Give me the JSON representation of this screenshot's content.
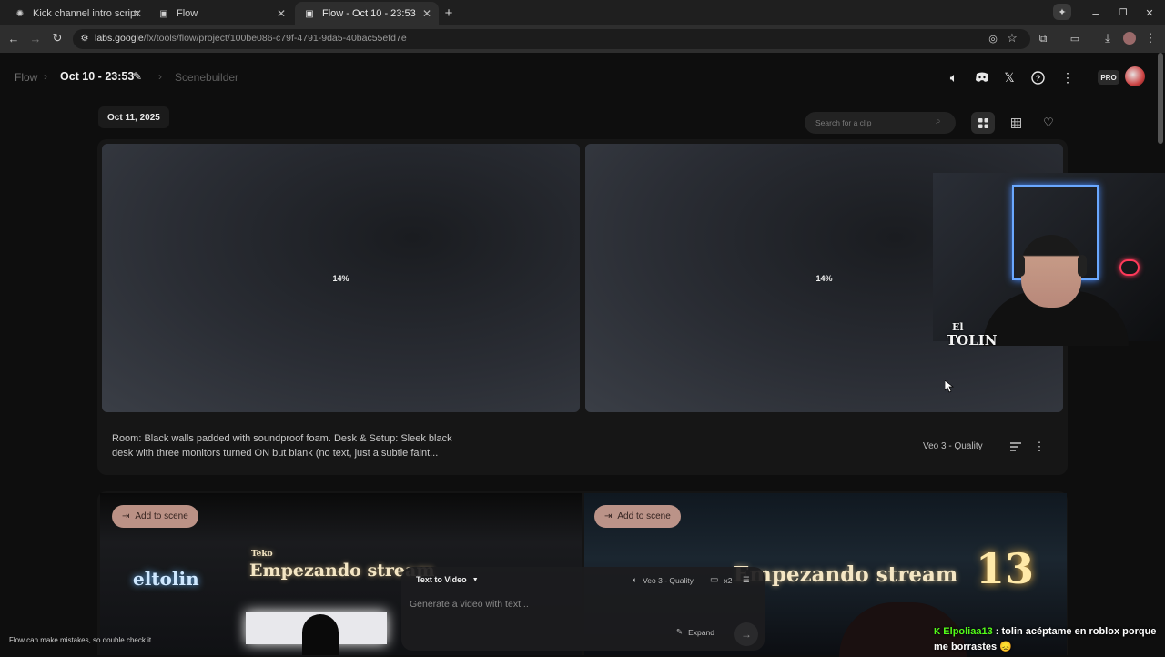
{
  "browser": {
    "tabs": [
      {
        "label": "Kick channel intro script",
        "icon": "gpt-icon"
      },
      {
        "label": "Flow",
        "icon": "flow-icon"
      },
      {
        "label": "Flow - Oct 10 - 23:53",
        "icon": "flow-icon",
        "active": true
      }
    ],
    "url_host": "labs.google",
    "url_path": "/fx/tools/flow/project/100be086-c79f-4791-9da5-40bac55efd7e"
  },
  "header": {
    "crumb_root": "Flow",
    "project_title": "Oct 10 - 23:53",
    "crumb_section": "Scenebuilder",
    "pro_badge": "PRO"
  },
  "toolbar": {
    "date_chip": "Oct 11, 2025",
    "search_placeholder": "Search for a clip"
  },
  "clip": {
    "progress_left": "14%",
    "progress_right": "14%",
    "prompt": "Room: Black walls padded with soundproof foam. Desk & Setup: Sleek black desk with three monitors turned ON but blank (no text, just a subtle faint...",
    "model": "Veo 3 - Quality"
  },
  "scenes": {
    "add_label": "Add to scene",
    "left_small_title": "Teko",
    "left_title": "Empezando stream",
    "left_logo": "eltolin",
    "right_title": "Empezando stream",
    "right_number": "13"
  },
  "composer": {
    "mode": "Text to Video",
    "model": "Veo 3 - Quality",
    "count": "x2",
    "placeholder": "Generate a video with text...",
    "expand": "Expand"
  },
  "footer": {
    "disclaimer": "Flow can make mistakes, so double check it"
  },
  "stream_overlay": {
    "cam_logo_line1": "El",
    "cam_logo_line2": "TOLIN",
    "chat_user": "Elpoliaa13",
    "chat_message": " : tolin acéptame en roblox porque me borrastes 😞"
  },
  "colors": {
    "accent_add": "#d9a89a",
    "chat_user": "#53fc18",
    "neon": "#6aa8ff"
  }
}
